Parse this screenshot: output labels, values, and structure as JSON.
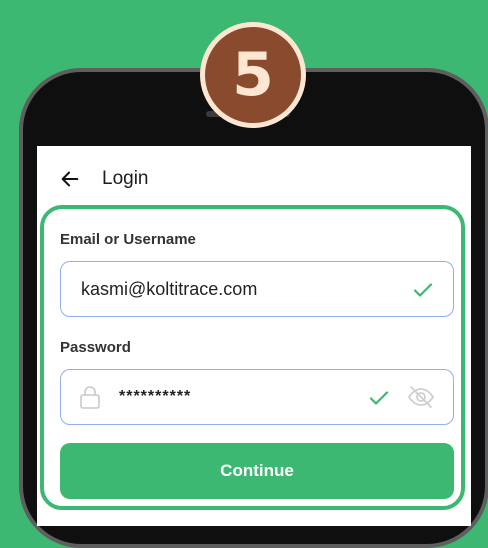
{
  "step": {
    "number": "5"
  },
  "header": {
    "title": "Login",
    "back_icon": "arrow-left-icon"
  },
  "form": {
    "email_label": "Email or Username",
    "email_value": "kasmi@koltitrace.com",
    "password_label": "Password",
    "password_value": "**********",
    "continue_label": "Continue"
  },
  "icons": {
    "valid": "check-icon",
    "lock": "lock-icon",
    "visibility": "eye-off-icon"
  },
  "colors": {
    "background": "#3db872",
    "accent": "#3db872",
    "badge": "#8a4a2e",
    "input_border": "#8fb0ec"
  }
}
